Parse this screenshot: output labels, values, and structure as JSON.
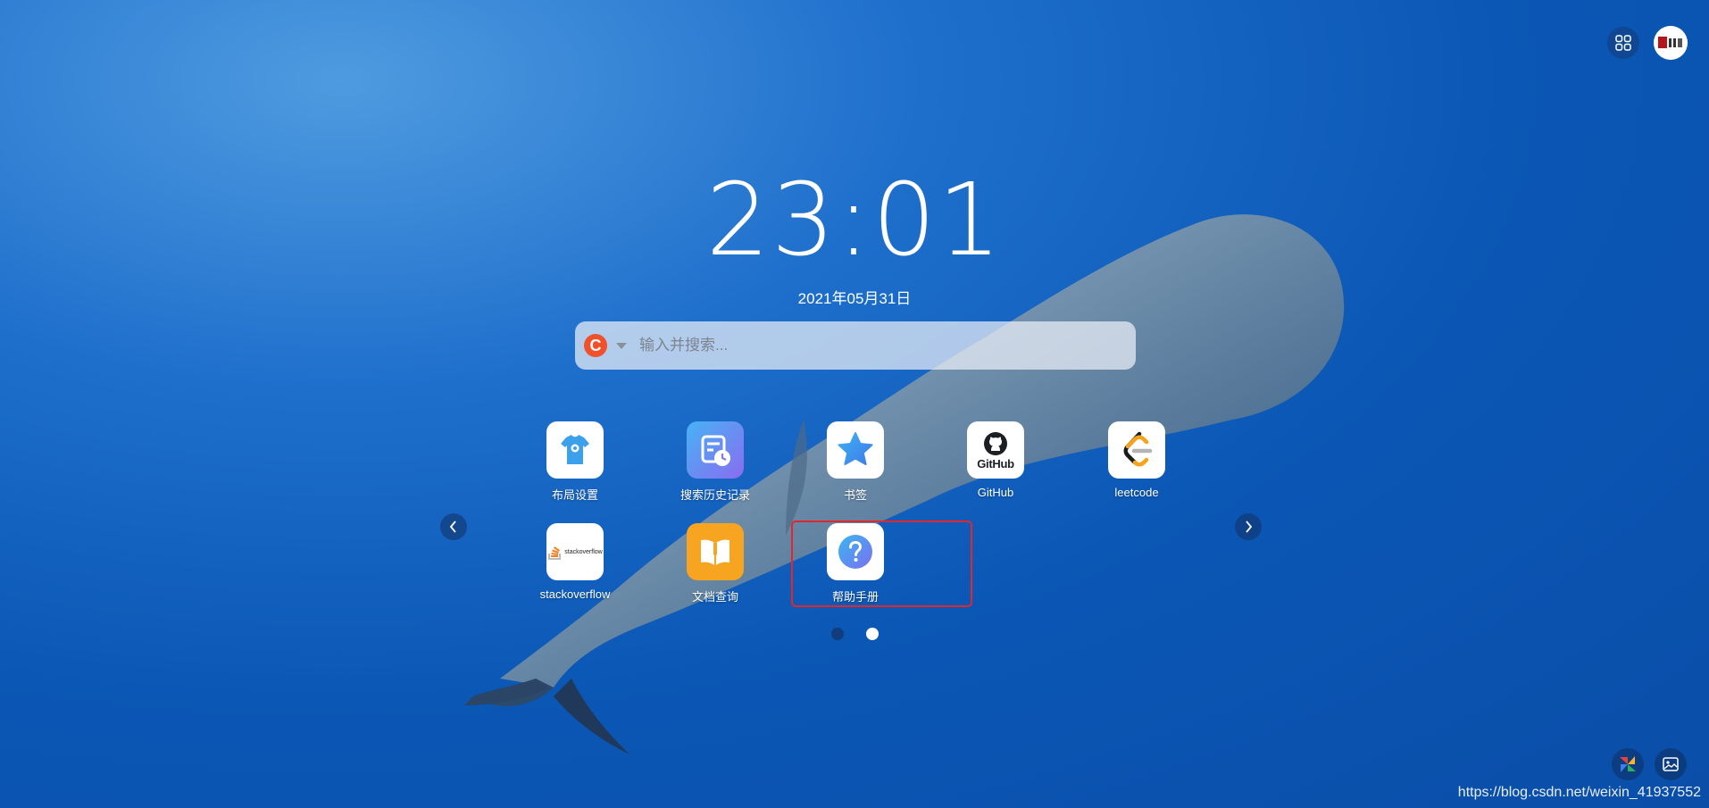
{
  "clock": {
    "time": "23:01",
    "date": "2021年05月31日"
  },
  "search": {
    "engine_letter": "C",
    "placeholder": "输入并搜索..."
  },
  "apps": [
    {
      "label": "布局设置",
      "icon": "tshirt-settings-icon"
    },
    {
      "label": "搜索历史记录",
      "icon": "history-clock-icon"
    },
    {
      "label": "书签",
      "icon": "star-icon"
    },
    {
      "label": "GitHub",
      "icon": "github-icon"
    },
    {
      "label": "leetcode",
      "icon": "leetcode-icon"
    },
    {
      "label": "stackoverflow",
      "icon": "stackoverflow-icon"
    },
    {
      "label": "文档查询",
      "icon": "book-icon"
    },
    {
      "label": "帮助手册",
      "icon": "question-icon"
    }
  ],
  "icon_text": {
    "github": "GitHub",
    "stackoverflow": "stackoverflow"
  },
  "pagination": {
    "pages": 2,
    "current": 2
  },
  "watermark": "https://blog.csdn.net/weixin_41937552",
  "colors": {
    "accent_red": "#e3262a",
    "engine": "#f0512a"
  }
}
